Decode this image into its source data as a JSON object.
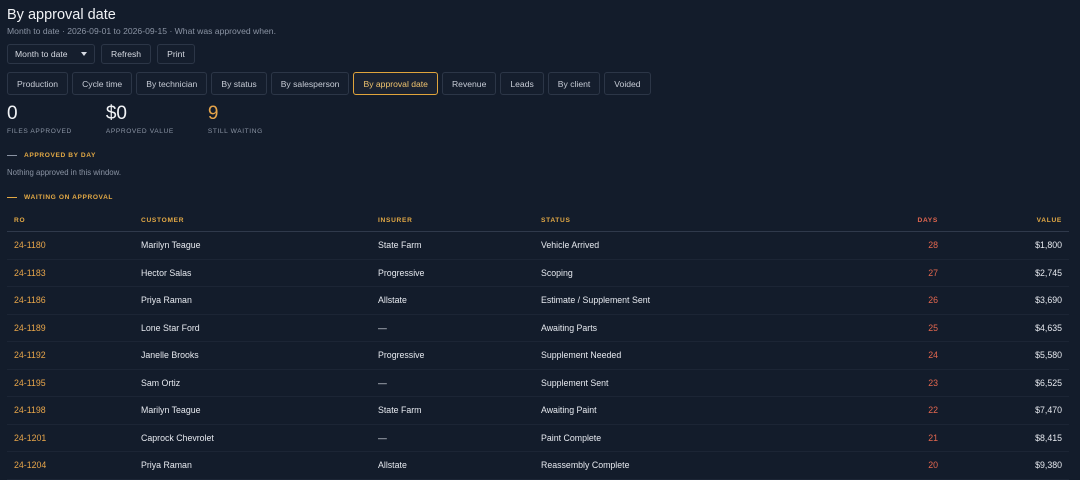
{
  "header": {
    "title": "By approval date",
    "subtitle": "Month to date · 2026-09-01 to 2026-09-15 · What was approved when."
  },
  "controls": {
    "range_value": "Month to date",
    "refresh_label": "Refresh",
    "print_label": "Print"
  },
  "tabs": [
    {
      "label": "Production"
    },
    {
      "label": "Cycle time"
    },
    {
      "label": "By technician"
    },
    {
      "label": "By status"
    },
    {
      "label": "By salesperson"
    },
    {
      "label": "By approval date",
      "active": true
    },
    {
      "label": "Revenue"
    },
    {
      "label": "Leads"
    },
    {
      "label": "By client"
    },
    {
      "label": "Voided"
    }
  ],
  "stats": {
    "files_approved": {
      "value": "0",
      "label": "FILES APPROVED"
    },
    "approved_value": {
      "value": "$0",
      "label": "APPROVED VALUE"
    },
    "still_waiting": {
      "value": "9",
      "label": "STILL WAITING"
    }
  },
  "sections": {
    "approved_by_day": "APPROVED BY DAY",
    "empty_message": "Nothing approved in this window.",
    "waiting": "WAITING ON APPROVAL"
  },
  "table": {
    "headers": {
      "ro": "RO",
      "customer": "CUSTOMER",
      "insurer": "INSURER",
      "status": "STATUS",
      "days": "DAYS",
      "value": "VALUE"
    },
    "rows": [
      {
        "ro": "24-1180",
        "customer": "Marilyn Teague",
        "insurer": "State Farm",
        "status": "Vehicle Arrived",
        "days": "28",
        "value": "$1,800"
      },
      {
        "ro": "24-1183",
        "customer": "Hector Salas",
        "insurer": "Progressive",
        "status": "Scoping",
        "days": "27",
        "value": "$2,745"
      },
      {
        "ro": "24-1186",
        "customer": "Priya Raman",
        "insurer": "Allstate",
        "status": "Estimate / Supplement Sent",
        "days": "26",
        "value": "$3,690"
      },
      {
        "ro": "24-1189",
        "customer": "Lone Star Ford",
        "insurer": "—",
        "status": "Awaiting Parts",
        "days": "25",
        "value": "$4,635"
      },
      {
        "ro": "24-1192",
        "customer": "Janelle Brooks",
        "insurer": "Progressive",
        "status": "Supplement Needed",
        "days": "24",
        "value": "$5,580"
      },
      {
        "ro": "24-1195",
        "customer": "Sam Ortiz",
        "insurer": "—",
        "status": "Supplement Sent",
        "days": "23",
        "value": "$6,525"
      },
      {
        "ro": "24-1198",
        "customer": "Marilyn Teague",
        "insurer": "State Farm",
        "status": "Awaiting Paint",
        "days": "22",
        "value": "$7,470"
      },
      {
        "ro": "24-1201",
        "customer": "Caprock Chevrolet",
        "insurer": "—",
        "status": "Paint Complete",
        "days": "21",
        "value": "$8,415"
      },
      {
        "ro": "24-1204",
        "customer": "Priya Raman",
        "insurer": "Allstate",
        "status": "Reassembly Complete",
        "days": "20",
        "value": "$9,380"
      }
    ]
  }
}
